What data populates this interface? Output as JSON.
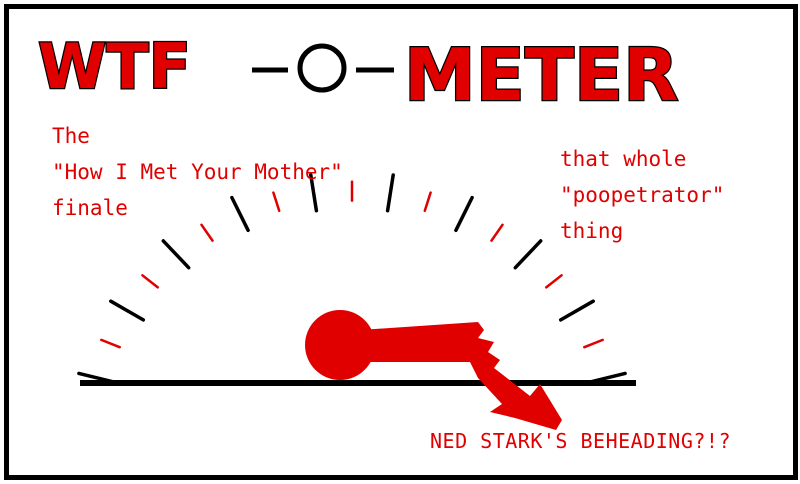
{
  "title": {
    "part1": "WTF",
    "part2": "O",
    "part3": "METER",
    "text": "WTF-O-METER"
  },
  "labels": {
    "left_line1": "The",
    "left_line2": "\"How I Met Your Mother\"",
    "left_line3": "finale",
    "right_line1": "that whole",
    "right_line2": "\"poopetrator\"",
    "right_line3": "thing",
    "bottom": "NED STARK'S BEHEADING?!?"
  },
  "gauge": {
    "needle_color": "#e00000",
    "tick_major_color": "#000000",
    "tick_minor_color": "#e00000"
  }
}
